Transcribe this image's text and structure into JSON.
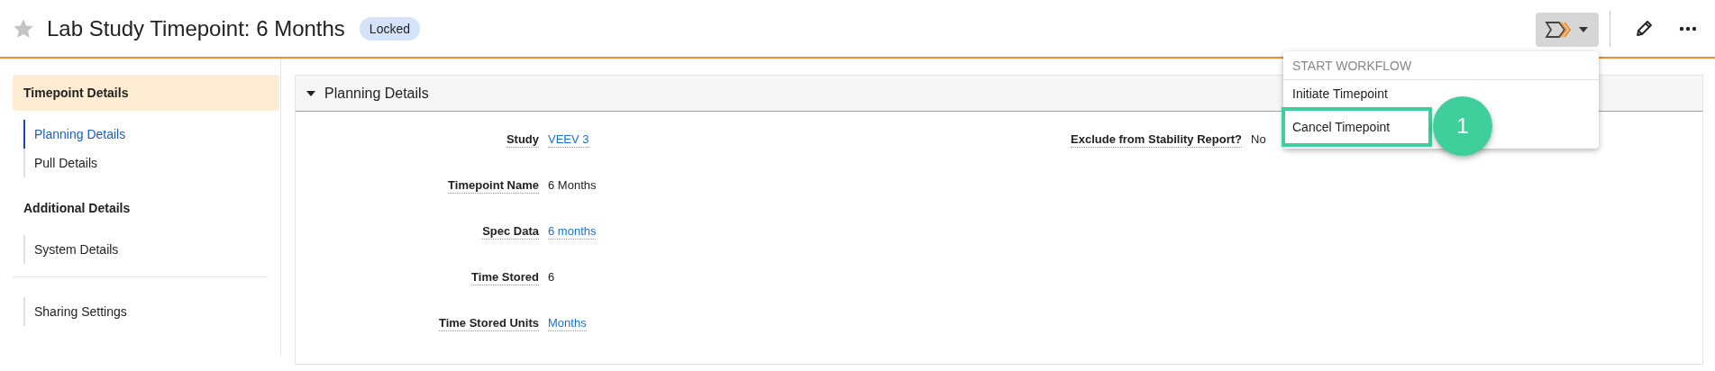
{
  "header": {
    "title": "Lab Study Timepoint: 6 Months",
    "favorite": false,
    "badge": "Locked"
  },
  "workflow_menu": {
    "expanded": true,
    "heading": "START WORKFLOW",
    "items": [
      {
        "label": "Initiate Timepoint",
        "highlighted": false
      },
      {
        "label": "Cancel Timepoint",
        "highlighted": true
      }
    ],
    "callout": "1"
  },
  "sidebar": {
    "sections": [
      {
        "title": "Timepoint Details",
        "selected": true,
        "items": [
          {
            "label": "Planning Details",
            "selected": true
          },
          {
            "label": "Pull Details",
            "selected": false
          }
        ]
      },
      {
        "title": "Additional Details",
        "selected": false,
        "items": [
          {
            "label": "System Details",
            "selected": false
          }
        ]
      },
      {
        "items": [
          {
            "label": "Sharing Settings",
            "selected": false
          }
        ]
      }
    ]
  },
  "panel": {
    "title": "Planning Details",
    "expanded": true,
    "columns": [
      [
        {
          "label": "Study",
          "value": "VEEV 3",
          "kind": "link"
        },
        {
          "label": "Timepoint Name",
          "value": "6 Months",
          "kind": "text"
        },
        {
          "label": "Spec Data",
          "value": "6 months",
          "kind": "link"
        },
        {
          "label": "Time Stored",
          "value": "6",
          "kind": "text"
        },
        {
          "label": "Time Stored Units",
          "value": "Months",
          "kind": "link"
        }
      ],
      [
        {
          "label": "Exclude from Stability Report?",
          "value": "No",
          "kind": "text"
        }
      ]
    ]
  }
}
